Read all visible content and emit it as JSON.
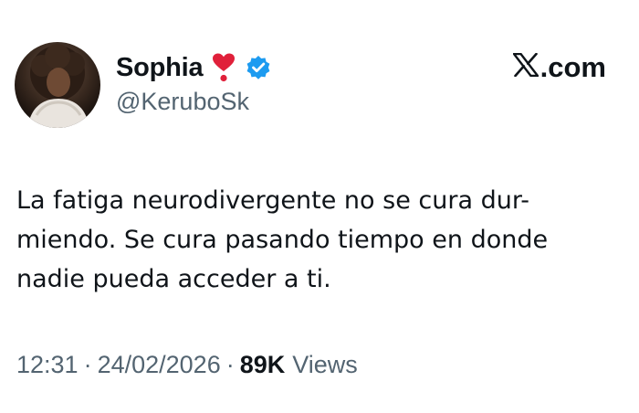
{
  "author": {
    "display_name": "Sophia",
    "handle": "@KeruboSk",
    "emoji_icon": "heart-exclamation-icon",
    "verified_icon": "verified-badge-icon",
    "verified_color": "#1d9bf0",
    "heart_color": "#e0203a"
  },
  "site": {
    "logo_icon": "x-logo-icon",
    "label": ".com"
  },
  "tweet": {
    "lines": [
      "La fatiga neurodivergente no se cura dur-",
      "miendo. Se cura pasando tiempo en donde",
      "nadie pueda acceder a ti."
    ]
  },
  "meta": {
    "time": "12:31",
    "date": "24/02/2026",
    "separator": "·",
    "views_count": "89K",
    "views_label": "Views"
  }
}
